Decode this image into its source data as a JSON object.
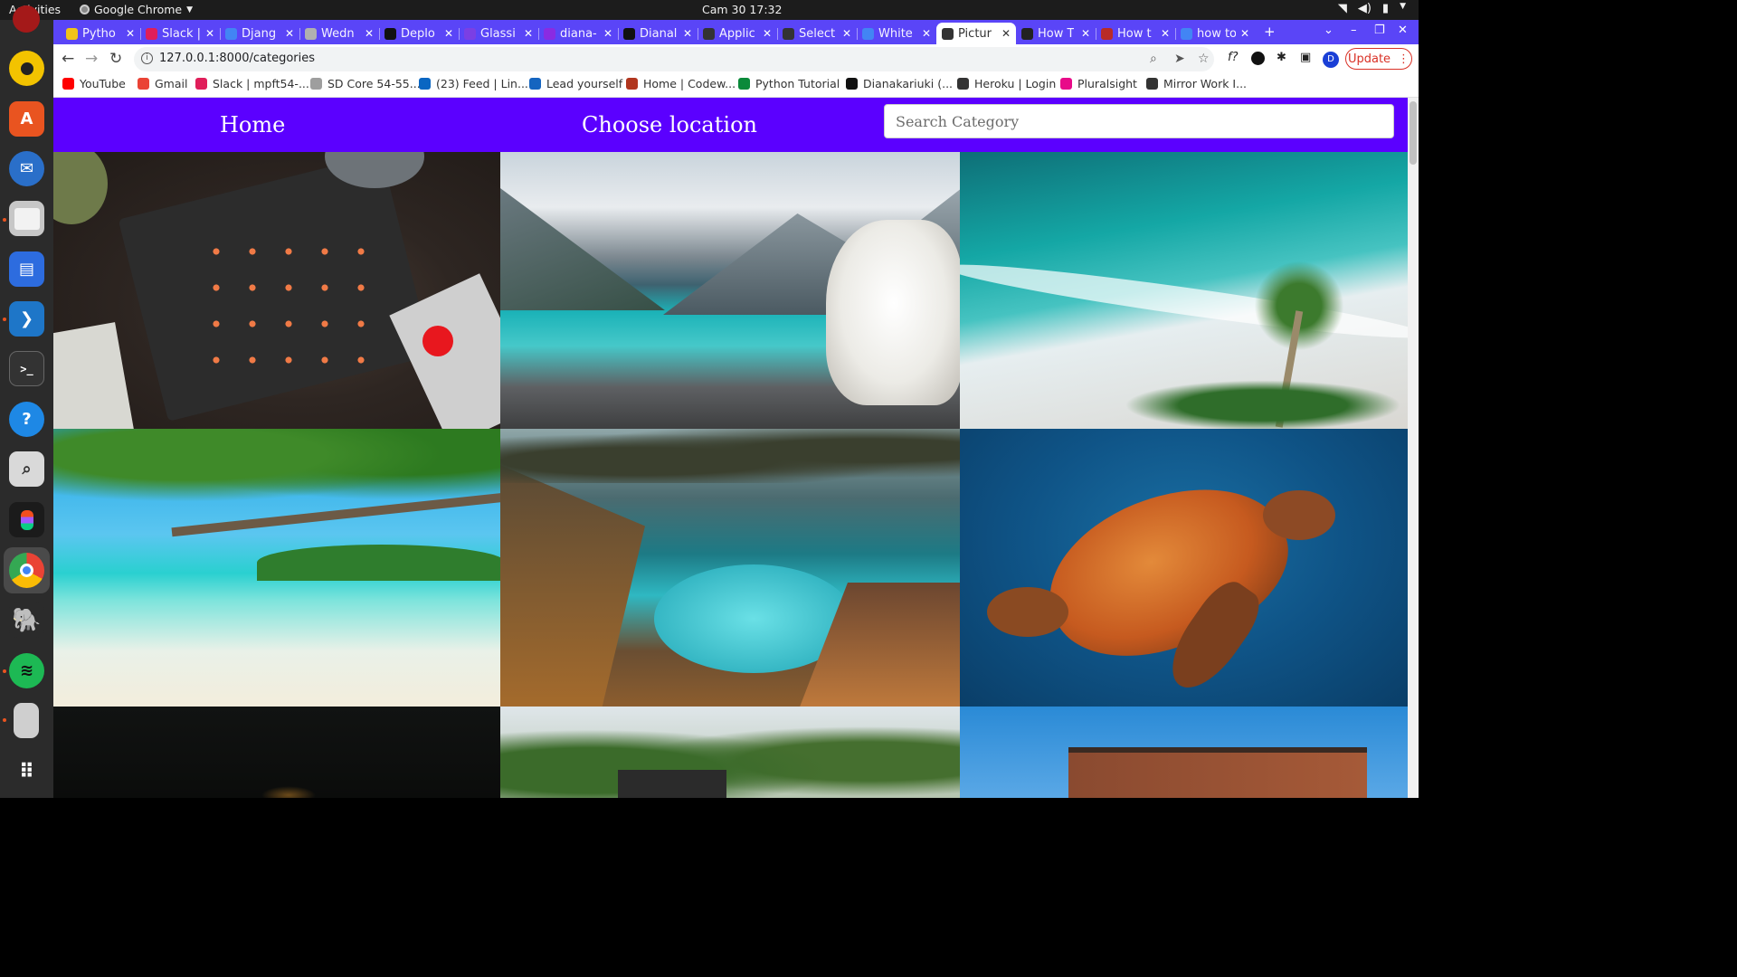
{
  "system": {
    "activities": "Activities",
    "app_menu": "Google Chrome",
    "clock": "Cam 30  17:32"
  },
  "tabs": [
    {
      "label": "Pytho",
      "color": "#f0c419"
    },
    {
      "label": "Slack |",
      "color": "#e01e5a"
    },
    {
      "label": "Djang",
      "color": "#4285f4"
    },
    {
      "label": "Wedn",
      "color": "#b0b0b0"
    },
    {
      "label": "Deplo",
      "color": "#111111"
    },
    {
      "label": "Glassi",
      "color": "#7b3fe4"
    },
    {
      "label": "diana-",
      "color": "#8a2be2"
    },
    {
      "label": "Dianal",
      "color": "#111111"
    },
    {
      "label": "Applic",
      "color": "#333333"
    },
    {
      "label": "Select",
      "color": "#333333"
    },
    {
      "label": "White",
      "color": "#4285f4"
    },
    {
      "label": "Pictur",
      "color": "#333333"
    },
    {
      "label": "How T",
      "color": "#222222"
    },
    {
      "label": "How t",
      "color": "#b92b27"
    },
    {
      "label": "how to",
      "color": "#4285f4"
    }
  ],
  "active_tab_index": 11,
  "address": {
    "url": "127.0.0.1:8000/categories"
  },
  "update_button": "Update",
  "profile_initial": "D",
  "bookmarks": [
    {
      "label": "YouTube",
      "color": "#ff0000"
    },
    {
      "label": "Gmail",
      "color": "#ea4335"
    },
    {
      "label": "Slack | mpft54-...",
      "color": "#e01e5a"
    },
    {
      "label": "SD Core 54-55...",
      "color": "#9e9e9e"
    },
    {
      "label": "(23) Feed | Lin...",
      "color": "#0a66c2"
    },
    {
      "label": "Lead yourself",
      "color": "#1565c0"
    },
    {
      "label": "Home | Codew...",
      "color": "#b1361e"
    },
    {
      "label": "Python Tutorial",
      "color": "#0a8a3a"
    },
    {
      "label": "Dianakariuki (...",
      "color": "#111111"
    },
    {
      "label": "Heroku | Login",
      "color": "#333333"
    },
    {
      "label": "Pluralsight",
      "color": "#e80a89"
    },
    {
      "label": "Mirror Work I...",
      "color": "#333333"
    }
  ],
  "site_nav": {
    "home": "Home",
    "choose_location": "Choose location",
    "search_placeholder": "Search Category",
    "background": "#5b00ff"
  },
  "gallery": [
    {
      "name": "sushi-photo",
      "subject": "sushi platter"
    },
    {
      "name": "dog-lake-photo",
      "subject": "white dog by mountain lake"
    },
    {
      "name": "beach-aerial-photo",
      "subject": "aerial beach with palm tree"
    },
    {
      "name": "tropical-beach-photo",
      "subject": "tropical beach with branch"
    },
    {
      "name": "coastal-cove-photo",
      "subject": "coastal cove with waterfall"
    },
    {
      "name": "sea-turtle-photo",
      "subject": "sea turtle underwater"
    },
    {
      "name": "dark-photo",
      "subject": "dark night scene"
    },
    {
      "name": "trees-photo",
      "subject": "trees"
    },
    {
      "name": "building-photo",
      "subject": "modern building"
    }
  ]
}
